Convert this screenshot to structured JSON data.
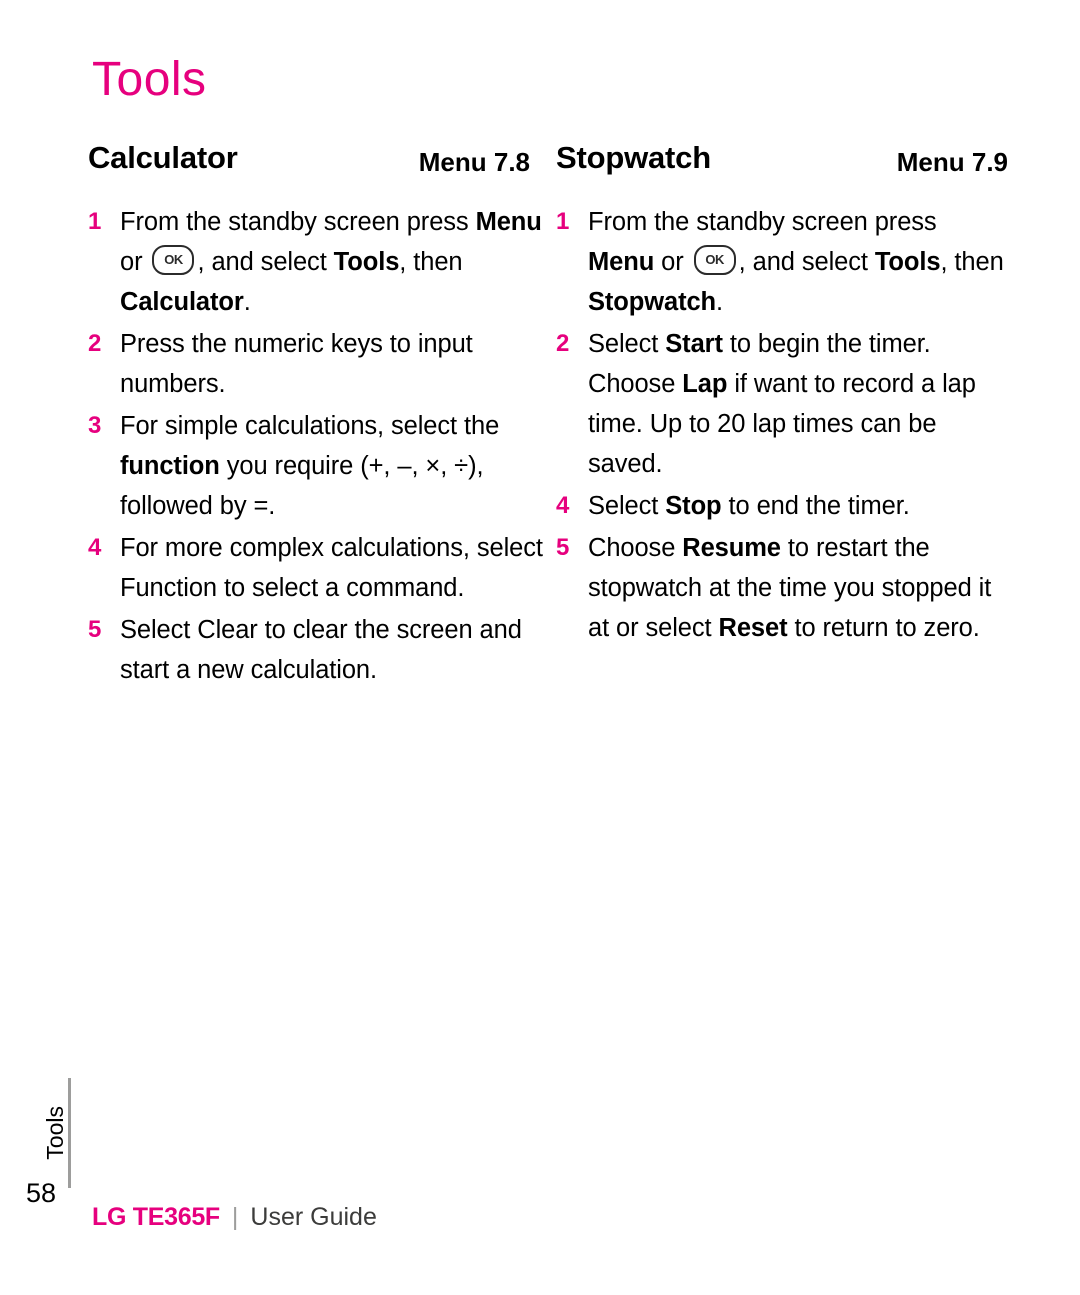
{
  "page": {
    "title": "Tools",
    "number": "58",
    "side_tab": "Tools"
  },
  "footer": {
    "brand": "LG TE365F",
    "separator": "|",
    "guide": "User Guide"
  },
  "sections": [
    {
      "title": "Calculator",
      "menu": "Menu 7.8",
      "steps": [
        {
          "num": "1",
          "parts": [
            {
              "t": "From the standby screen press ",
              "b": false
            },
            {
              "t": "Menu",
              "b": true
            },
            {
              "t": " or ",
              "b": false
            },
            {
              "t": "__OK__",
              "b": false
            },
            {
              "t": ", and select ",
              "b": false
            },
            {
              "t": "Tools",
              "b": true
            },
            {
              "t": ", then ",
              "b": false
            },
            {
              "t": "Calculator",
              "b": true
            },
            {
              "t": ".",
              "b": false
            }
          ]
        },
        {
          "num": "2",
          "parts": [
            {
              "t": "Press the numeric keys to input numbers.",
              "b": false
            }
          ]
        },
        {
          "num": "3",
          "parts": [
            {
              "t": "For simple calculations, select the ",
              "b": false
            },
            {
              "t": "function",
              "b": true
            },
            {
              "t": " you require (+, –, ×, ÷), followed by =.",
              "b": false
            }
          ]
        },
        {
          "num": "4",
          "parts": [
            {
              "t": "For more complex calculations, select Function to select a command.",
              "b": false
            }
          ]
        },
        {
          "num": "5",
          "parts": [
            {
              "t": "Select Clear to clear the screen and start a new calculation.",
              "b": false
            }
          ]
        }
      ]
    },
    {
      "title": "Stopwatch",
      "menu": "Menu 7.9",
      "steps": [
        {
          "num": "1",
          "parts": [
            {
              "t": "From the standby screen press ",
              "b": false
            },
            {
              "t": "Menu",
              "b": true
            },
            {
              "t": " or ",
              "b": false
            },
            {
              "t": "__OK__",
              "b": false
            },
            {
              "t": ", and select ",
              "b": false
            },
            {
              "t": "Tools",
              "b": true
            },
            {
              "t": ", then ",
              "b": false
            },
            {
              "t": "Stopwatch",
              "b": true
            },
            {
              "t": ".",
              "b": false
            }
          ]
        },
        {
          "num": "2",
          "parts": [
            {
              "t": "Select ",
              "b": false
            },
            {
              "t": "Start",
              "b": true
            },
            {
              "t": " to begin the timer. Choose ",
              "b": false
            },
            {
              "t": "Lap",
              "b": true
            },
            {
              "t": " if want to record a lap time. Up to 20 lap times can be saved.",
              "b": false
            }
          ]
        },
        {
          "num": "4",
          "parts": [
            {
              "t": "Select ",
              "b": false
            },
            {
              "t": "Stop",
              "b": true
            },
            {
              "t": " to end the timer.",
              "b": false
            }
          ]
        },
        {
          "num": "5",
          "parts": [
            {
              "t": "Choose ",
              "b": false
            },
            {
              "t": "Resume",
              "b": true
            },
            {
              "t": " to restart the stopwatch at the time you stopped it at or select ",
              "b": false
            },
            {
              "t": "Reset",
              "b": true
            },
            {
              "t": " to return to zero.",
              "b": false
            }
          ]
        }
      ]
    }
  ],
  "icons": {
    "ok_key_label": "OK"
  }
}
